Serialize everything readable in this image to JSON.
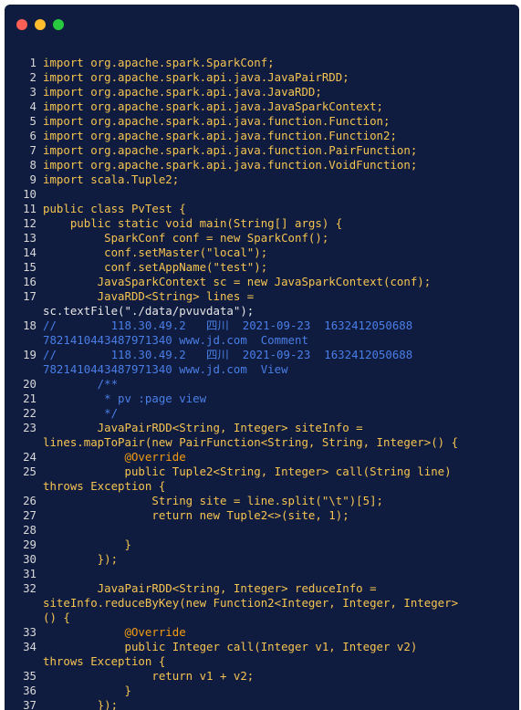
{
  "window": {
    "controls": {
      "close_color": "#ff5f56",
      "minimize_color": "#ffbd2e",
      "maximize_color": "#27c93f"
    }
  },
  "code": {
    "line_numbers": [
      "1",
      "2",
      "3",
      "4",
      "5",
      "6",
      "7",
      "8",
      "9",
      "10",
      "11",
      "12",
      "13",
      "14",
      "15",
      "16",
      "17",
      "18",
      "19",
      "20",
      "21",
      "22",
      "23",
      "24",
      "25",
      "26",
      "27",
      "28",
      "29",
      "30",
      "31",
      "32",
      "33",
      "34",
      "35",
      "36",
      "37"
    ],
    "lines": [
      "import org.apache.spark.SparkConf;",
      "import org.apache.spark.api.java.JavaPairRDD;",
      "import org.apache.spark.api.java.JavaRDD;",
      "import org.apache.spark.api.java.JavaSparkContext;",
      "import org.apache.spark.api.java.function.Function;",
      "import org.apache.spark.api.java.function.Function2;",
      "import org.apache.spark.api.java.function.PairFunction;",
      "import org.apache.spark.api.java.function.VoidFunction;",
      "import scala.Tuple2;",
      "",
      "public class PvTest {",
      "    public static void main(String[] args) {",
      "         SparkConf conf = new SparkConf();",
      "         conf.setMaster(\"local\");",
      "         conf.setAppName(\"test\");",
      "        JavaSparkContext sc = new JavaSparkContext(conf);",
      "        JavaRDD<String> lines =",
      "sc.textFile(\"./data/pvuvdata\");",
      "//        118.30.49.2   四川  2021-09-23  1632412050688",
      "7821410443487971340 www.jd.com  Comment",
      "//        118.30.49.2   四川  2021-09-23  1632412050688",
      "7821410443487971340 www.jd.com  View",
      "        /**",
      "         * pv :page view",
      "         */",
      "        JavaPairRDD<String, Integer> siteInfo =",
      "lines.mapToPair(new PairFunction<String, String, Integer>() {",
      "            @Override",
      "            public Tuple2<String, Integer> call(String line)",
      "throws Exception {",
      "                String site = line.split(\"\\t\")[5];",
      "                return new Tuple2<>(site, 1);",
      "",
      "            }",
      "        });",
      "",
      "        JavaPairRDD<String, Integer> reduceInfo =",
      "siteInfo.reduceByKey(new Function2<Integer, Integer, Integer>",
      "() {",
      "            @Override",
      "            public Integer call(Integer v1, Integer v2)",
      "throws Exception {",
      "                return v1 + v2;",
      "            }",
      "        });"
    ]
  },
  "colors": {
    "background": "#0f1c3f",
    "keyword": "#f6c451",
    "string": "#7fe38a",
    "comment": "#4a7ee6",
    "annotation": "#f39c12",
    "text": "#e6e6e6"
  }
}
